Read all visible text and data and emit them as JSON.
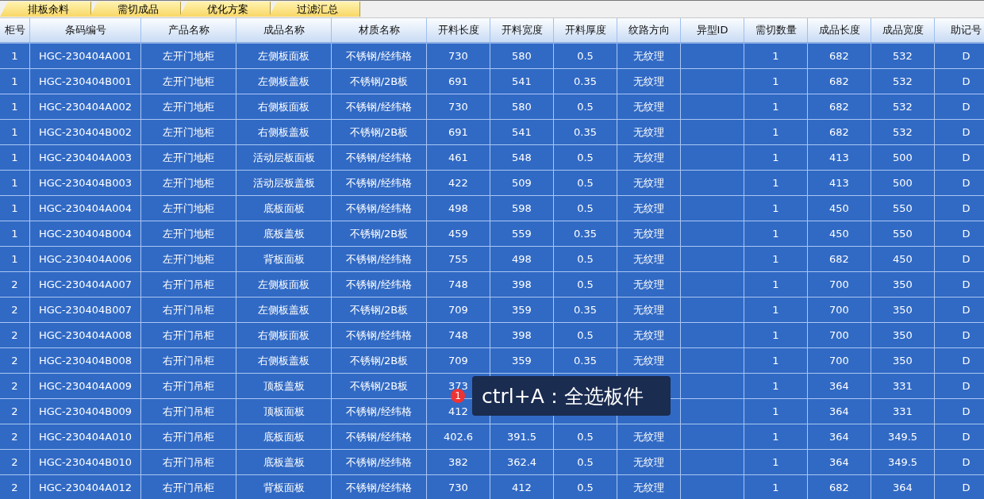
{
  "tabs": [
    {
      "label": "排板余料",
      "selected": false
    },
    {
      "label": "需切成品",
      "selected": false
    },
    {
      "label": "优化方案",
      "selected": false
    },
    {
      "label": "过滤汇总",
      "selected": false
    }
  ],
  "table": {
    "columns": [
      "柜号",
      "条码编号",
      "产品名称",
      "成品名称",
      "材质名称",
      "开料长度",
      "开料宽度",
      "开料厚度",
      "纹路方向",
      "异型ID",
      "需切数量",
      "成品长度",
      "成品宽度",
      "助记号"
    ],
    "rows": [
      {
        "selected": true,
        "cells": [
          "1",
          "HGC-230404A001",
          "左开门地柜",
          "左侧板面板",
          "不锈钢/经纬格",
          "730",
          "580",
          "0.5",
          "无纹理",
          "",
          "1",
          "682",
          "532",
          "D"
        ]
      },
      {
        "selected": true,
        "cells": [
          "1",
          "HGC-230404B001",
          "左开门地柜",
          "左侧板盖板",
          "不锈钢/2B板",
          "691",
          "541",
          "0.35",
          "无纹理",
          "",
          "1",
          "682",
          "532",
          "D"
        ]
      },
      {
        "selected": true,
        "cells": [
          "1",
          "HGC-230404A002",
          "左开门地柜",
          "右侧板面板",
          "不锈钢/经纬格",
          "730",
          "580",
          "0.5",
          "无纹理",
          "",
          "1",
          "682",
          "532",
          "D"
        ]
      },
      {
        "selected": true,
        "cells": [
          "1",
          "HGC-230404B002",
          "左开门地柜",
          "右侧板盖板",
          "不锈钢/2B板",
          "691",
          "541",
          "0.35",
          "无纹理",
          "",
          "1",
          "682",
          "532",
          "D"
        ]
      },
      {
        "selected": true,
        "cells": [
          "1",
          "HGC-230404A003",
          "左开门地柜",
          "活动层板面板",
          "不锈钢/经纬格",
          "461",
          "548",
          "0.5",
          "无纹理",
          "",
          "1",
          "413",
          "500",
          "D"
        ]
      },
      {
        "selected": true,
        "cells": [
          "1",
          "HGC-230404B003",
          "左开门地柜",
          "活动层板盖板",
          "不锈钢/经纬格",
          "422",
          "509",
          "0.5",
          "无纹理",
          "",
          "1",
          "413",
          "500",
          "D"
        ]
      },
      {
        "selected": true,
        "cells": [
          "1",
          "HGC-230404A004",
          "左开门地柜",
          "底板面板",
          "不锈钢/经纬格",
          "498",
          "598",
          "0.5",
          "无纹理",
          "",
          "1",
          "450",
          "550",
          "D"
        ]
      },
      {
        "selected": true,
        "cells": [
          "1",
          "HGC-230404B004",
          "左开门地柜",
          "底板盖板",
          "不锈钢/2B板",
          "459",
          "559",
          "0.35",
          "无纹理",
          "",
          "1",
          "450",
          "550",
          "D"
        ]
      },
      {
        "selected": true,
        "cells": [
          "1",
          "HGC-230404A006",
          "左开门地柜",
          "背板面板",
          "不锈钢/经纬格",
          "755",
          "498",
          "0.5",
          "无纹理",
          "",
          "1",
          "682",
          "450",
          "D"
        ]
      },
      {
        "selected": true,
        "cells": [
          "2",
          "HGC-230404A007",
          "右开门吊柜",
          "左侧板面板",
          "不锈钢/经纬格",
          "748",
          "398",
          "0.5",
          "无纹理",
          "",
          "1",
          "700",
          "350",
          "D"
        ]
      },
      {
        "selected": true,
        "cells": [
          "2",
          "HGC-230404B007",
          "右开门吊柜",
          "左侧板盖板",
          "不锈钢/2B板",
          "709",
          "359",
          "0.35",
          "无纹理",
          "",
          "1",
          "700",
          "350",
          "D"
        ]
      },
      {
        "selected": true,
        "cells": [
          "2",
          "HGC-230404A008",
          "右开门吊柜",
          "右侧板面板",
          "不锈钢/经纬格",
          "748",
          "398",
          "0.5",
          "无纹理",
          "",
          "1",
          "700",
          "350",
          "D"
        ]
      },
      {
        "selected": true,
        "cells": [
          "2",
          "HGC-230404B008",
          "右开门吊柜",
          "右侧板盖板",
          "不锈钢/2B板",
          "709",
          "359",
          "0.35",
          "无纹理",
          "",
          "1",
          "700",
          "350",
          "D"
        ]
      },
      {
        "selected": true,
        "cells": [
          "2",
          "HGC-230404A009",
          "右开门吊柜",
          "顶板盖板",
          "不锈钢/2B板",
          "373",
          null,
          null,
          null,
          "",
          "1",
          "364",
          "331",
          "D"
        ]
      },
      {
        "selected": true,
        "cells": [
          "2",
          "HGC-230404B009",
          "右开门吊柜",
          "顶板面板",
          "不锈钢/经纬格",
          "412",
          null,
          null,
          null,
          "",
          "1",
          "364",
          "331",
          "D"
        ]
      },
      {
        "selected": true,
        "cells": [
          "2",
          "HGC-230404A010",
          "右开门吊柜",
          "底板面板",
          "不锈钢/经纬格",
          "402.6",
          "391.5",
          "0.5",
          "无纹理",
          "",
          "1",
          "364",
          "349.5",
          "D"
        ]
      },
      {
        "selected": true,
        "cells": [
          "2",
          "HGC-230404B010",
          "右开门吊柜",
          "底板盖板",
          "不锈钢/经纬格",
          "382",
          "362.4",
          "0.5",
          "无纹理",
          "",
          "1",
          "364",
          "349.5",
          "D"
        ]
      },
      {
        "selected": true,
        "cells": [
          "2",
          "HGC-230404A012",
          "右开门吊柜",
          "背板面板",
          "不锈钢/经纬格",
          "730",
          "412",
          "0.5",
          "无纹理",
          "",
          "1",
          "682",
          "364",
          "D"
        ]
      }
    ]
  },
  "tooltip": {
    "badge": "1",
    "text": "ctrl+A：全选板件"
  }
}
